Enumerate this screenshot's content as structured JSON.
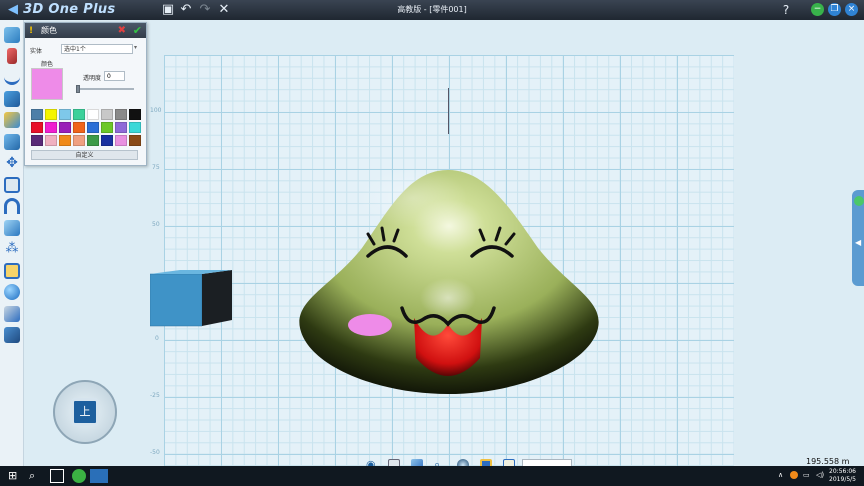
{
  "app": {
    "logo": "3D One Plus",
    "window_title": "高教版 - [零件001]"
  },
  "toolbar_top": [
    "save-icon",
    "undo-icon",
    "redo-icon",
    "close-icon"
  ],
  "window_controls": [
    "help-icon",
    "minimize",
    "restore",
    "close"
  ],
  "left_tools": [
    "primitive-shapes-icon",
    "sketch-icon",
    "curve-icon",
    "extrude-icon",
    "solid-edit-icon",
    "cube-icon",
    "move-icon",
    "combine-icon",
    "magnet-icon",
    "face-edit-icon",
    "array-icon",
    "measure-icon",
    "material-ball-icon",
    "layers-icon",
    "assembly-icon"
  ],
  "color_panel": {
    "title": "颜色",
    "entity_label": "实体",
    "entity_value": "选中1个",
    "color_label": "颜色",
    "opacity_label": "透明度",
    "opacity_value": "0",
    "custom_button": "自定义",
    "current_color": "#ee8be8",
    "swatches": [
      "#4d7fa8",
      "#f5f500",
      "#7ec8ea",
      "#3cd19a",
      "#ffffff",
      "#c8c8c8",
      "#8a8a8a",
      "#111111",
      "#e8102a",
      "#f01fd0",
      "#9a1fb8",
      "#f0641a",
      "#2b6fd6",
      "#6cc828",
      "#8e6ad8",
      "#3ad8d8",
      "#5a2a78",
      "#f0b0c0",
      "#f08a1a",
      "#f0a080",
      "#3c9a48",
      "#1830a0",
      "#e890e0",
      "#8a4a18"
    ]
  },
  "grid_labels": {
    "y": [
      "100",
      "75",
      "50",
      "25",
      "0",
      "-25",
      "-50"
    ]
  },
  "view_cube": {
    "face_label": "上"
  },
  "bottom_toolbar": [
    "eye-icon",
    "view-cube-icon",
    "view-3d-icon",
    "zoom-icon",
    "render-icon",
    "snapshot-icon",
    "grid-icon"
  ],
  "status": {
    "coordinate": "195.558",
    "unit": "m"
  },
  "taskbar": {
    "items": [
      "windows-start-icon",
      "search-icon",
      "task-view-icon",
      "app-green-icon",
      "3done-app-icon"
    ],
    "time": "20:56:06",
    "date": "2019/5/5"
  }
}
